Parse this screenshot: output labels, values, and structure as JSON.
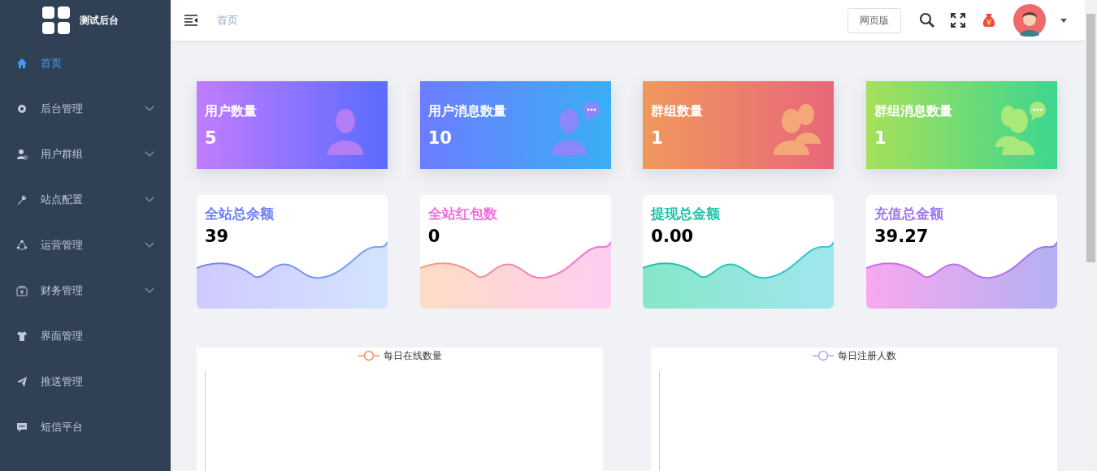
{
  "brand": {
    "title": "测试后台"
  },
  "sidebar": {
    "items": [
      {
        "label": "首页",
        "selected": true,
        "expandable": false
      },
      {
        "label": "后台管理",
        "selected": false,
        "expandable": true
      },
      {
        "label": "用户群组",
        "selected": false,
        "expandable": true
      },
      {
        "label": "站点配置",
        "selected": false,
        "expandable": true
      },
      {
        "label": "运营管理",
        "selected": false,
        "expandable": true
      },
      {
        "label": "财务管理",
        "selected": false,
        "expandable": true
      },
      {
        "label": "界面管理",
        "selected": false,
        "expandable": false
      },
      {
        "label": "推送管理",
        "selected": false,
        "expandable": false
      },
      {
        "label": "短信平台",
        "selected": false,
        "expandable": false
      }
    ]
  },
  "header": {
    "breadcrumb": "首页",
    "web_button": "网页版"
  },
  "stat_cards": [
    {
      "label": "用户数量",
      "value": "5"
    },
    {
      "label": "用户消息数量",
      "value": "10"
    },
    {
      "label": "群组数量",
      "value": "1"
    },
    {
      "label": "群组消息数量",
      "value": "1"
    }
  ],
  "total_cards": [
    {
      "label": "全站总余额",
      "value": "39",
      "color": "#6b7cf6"
    },
    {
      "label": "全站红包数",
      "value": "0",
      "color": "#f56ce0"
    },
    {
      "label": "提现总金额",
      "value": "0.00",
      "color": "#1fc2a8"
    },
    {
      "label": "充值总金额",
      "value": "39.27",
      "color": "#9b78ee"
    }
  ],
  "charts": [
    {
      "legend": "每日在线数量",
      "color": "#f4925c"
    },
    {
      "legend": "每日注册人数",
      "color": "#b9a7f5"
    }
  ]
}
